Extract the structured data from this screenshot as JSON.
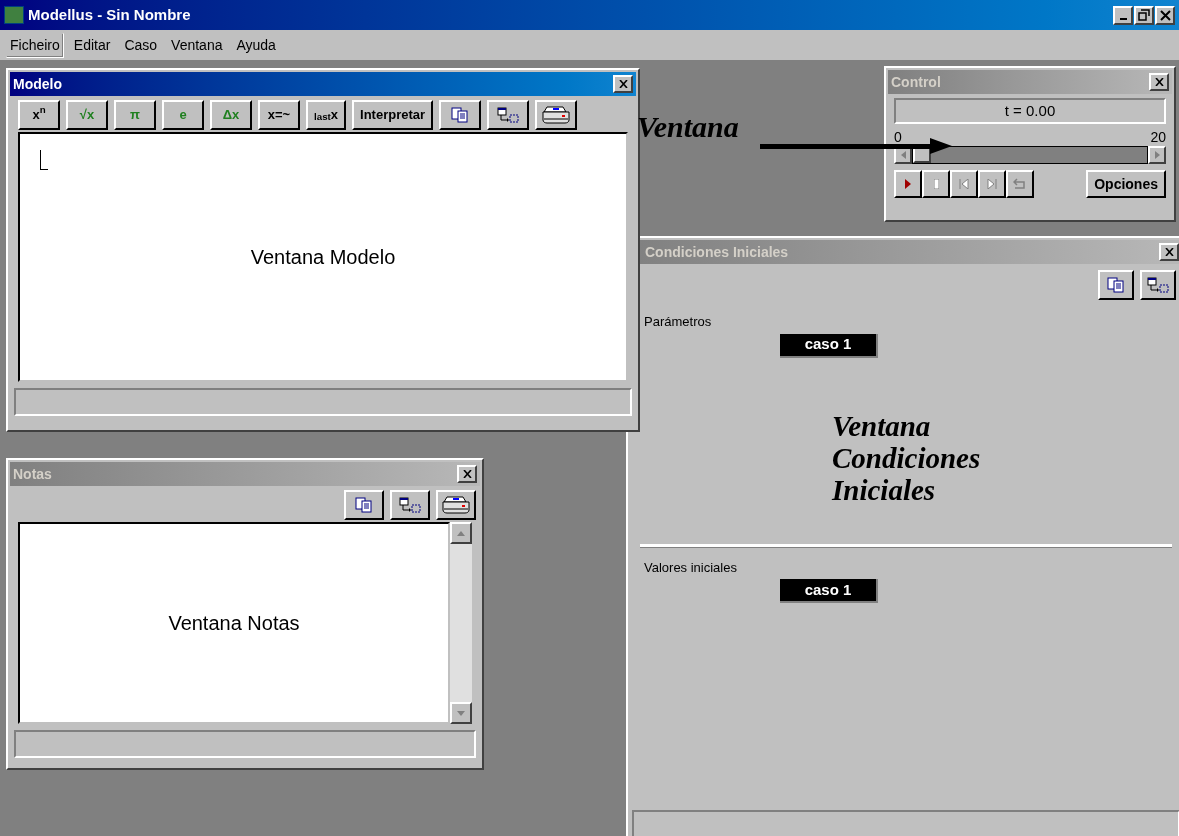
{
  "window": {
    "title": "Modellus - Sin Nombre"
  },
  "menu": [
    {
      "label": "Ficheiro",
      "selected": true
    },
    {
      "label": "Editar",
      "selected": false
    },
    {
      "label": "Caso",
      "selected": false
    },
    {
      "label": "Ventana",
      "selected": false
    },
    {
      "label": "Ayuda",
      "selected": false
    }
  ],
  "modelo_window": {
    "title": "Modelo",
    "active": true,
    "annotation": "Ventana Modelo",
    "toolbar": [
      {
        "kind": "text",
        "label": "x$^{n}$",
        "color": "#000000"
      },
      {
        "kind": "text",
        "label": "√x",
        "color": "#208020"
      },
      {
        "kind": "text",
        "label": "π",
        "color": "#208020"
      },
      {
        "kind": "text",
        "label": "e",
        "color": "#208020"
      },
      {
        "kind": "text",
        "label": "Δx",
        "color": "#208020"
      },
      {
        "kind": "text",
        "label": "x=~",
        "color": "#000000"
      },
      {
        "kind": "text",
        "label": "$_{last}$x",
        "color": "#000000"
      },
      {
        "kind": "text",
        "label": "Interpretar",
        "color": "#000000"
      },
      {
        "kind": "copy"
      },
      {
        "kind": "copy-to"
      },
      {
        "kind": "print"
      }
    ]
  },
  "callout": {
    "text": "Ventana"
  },
  "control_window": {
    "title": "Control",
    "active": false,
    "time_display": "t =  0.00",
    "slider": {
      "min_label": "0",
      "max_label": "20",
      "level": 0
    },
    "buttons": [
      {
        "kind": "play"
      },
      {
        "kind": "stop"
      },
      {
        "kind": "step-back"
      },
      {
        "kind": "step-forward"
      },
      {
        "kind": "replay"
      }
    ],
    "options_button": "Opciones"
  },
  "condiciones_window": {
    "title": "Condiciones Iniciales",
    "active": false,
    "toolbar": [
      {
        "kind": "copy"
      },
      {
        "kind": "copy-to"
      }
    ],
    "sections": [
      {
        "label": "Parámetros",
        "case_badge": "caso 1"
      },
      {
        "label": "Valores iniciales",
        "case_badge": "caso 1"
      }
    ],
    "annotation": "Ventana Condiciones Iniciales"
  },
  "notas_window": {
    "title": "Notas",
    "active": false,
    "toolbar": [
      {
        "kind": "copy"
      },
      {
        "kind": "copy-to"
      },
      {
        "kind": "print"
      }
    ],
    "annotation": "Ventana Notas"
  }
}
